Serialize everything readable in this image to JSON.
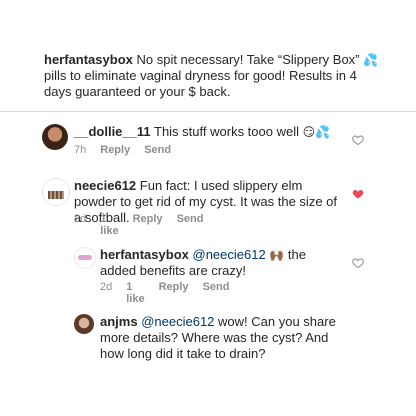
{
  "caption": {
    "username": "herfantasybox",
    "text_part1": " No spit necessary! Take “Slippery Box” ",
    "emoji1": "💦",
    "text_part2": " pills to eliminate vaginal dryness for good! Results in 4 days guaranteed or your $ back."
  },
  "comments": [
    {
      "username": "__dollie__11",
      "text": " This stuff works tooo well ",
      "emojis": "😏💦",
      "time": "7h",
      "likes": "",
      "reply_label": "Reply",
      "send_label": "Send",
      "liked": false
    },
    {
      "username": "neecie612",
      "text": " Fun fact: I used slippery elm powder to get rid of my cyst. It was the size of a softball.",
      "time": "2d",
      "likes": "1 like",
      "reply_label": "Reply",
      "send_label": "Send",
      "liked": true
    },
    {
      "username": "herfantasybox",
      "mention": "@neecie612",
      "emojis": "🙌🏾",
      "text": " the added benefits are crazy!",
      "time": "2d",
      "likes": "1 like",
      "reply_label": "Reply",
      "send_label": "Send",
      "liked": false
    },
    {
      "username": "anjms",
      "mention": "@neecie612",
      "text": " wow!  Can you share more details?  Where was the cyst?  And how long did it take to drain?",
      "liked": false
    }
  ],
  "colors": {
    "liked_heart": "#ed4956",
    "meta_gray": "#8e8e8e",
    "mention_blue": "#00376b"
  }
}
